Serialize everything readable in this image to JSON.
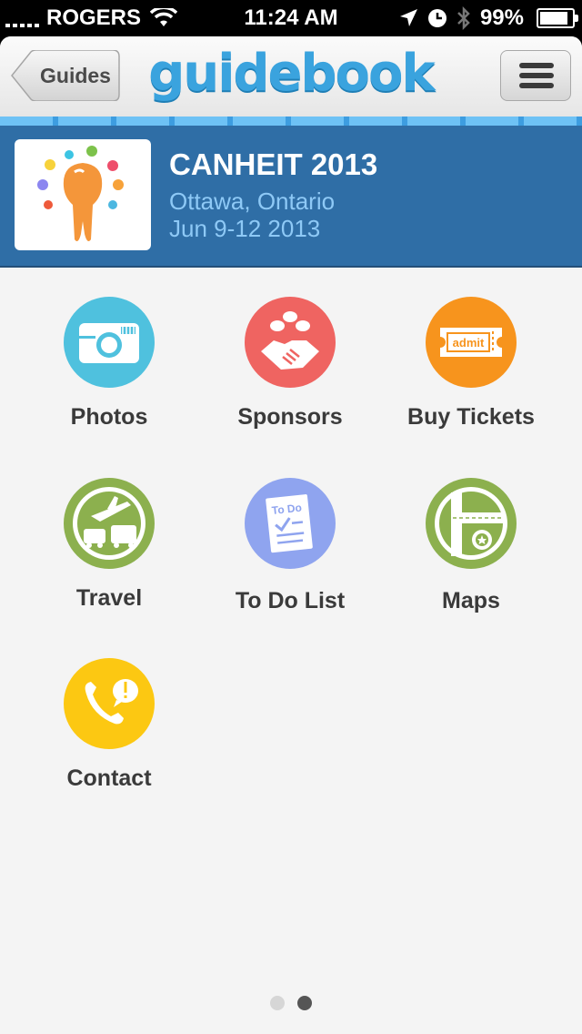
{
  "status_bar": {
    "carrier": "ROGERS",
    "time": "11:24 AM",
    "battery": "99%",
    "battery_level": 0.99
  },
  "nav": {
    "back_label": "Guides",
    "logo_text": "guidebook",
    "menu_icon": "hamburger-menu-icon"
  },
  "event": {
    "title": "CANHEIT 2013",
    "location": "Ottawa, Ontario",
    "dates": "Jun 9-12 2013"
  },
  "grid": [
    {
      "label": "Photos",
      "icon": "camera-icon",
      "color": "#4fc1de"
    },
    {
      "label": "Sponsors",
      "icon": "handshake-icon",
      "color": "#ef6461"
    },
    {
      "label": "Buy Tickets",
      "icon": "ticket-icon",
      "color": "#f7941d"
    },
    {
      "label": "Travel",
      "icon": "travel-icon",
      "color": "#8cb04e"
    },
    {
      "label": "To Do List",
      "icon": "todo-list-icon",
      "color": "#8fa4ef"
    },
    {
      "label": "Maps",
      "icon": "map-icon",
      "color": "#8cb04e"
    },
    {
      "label": "Contact",
      "icon": "phone-icon",
      "color": "#fcc812"
    }
  ],
  "ticket_text": "admit",
  "todo_text": "To Do",
  "page_indicator": {
    "pages": 2,
    "current": 2
  },
  "colors": {
    "header": "#2f6ea6",
    "logo": "#3aa3de"
  }
}
